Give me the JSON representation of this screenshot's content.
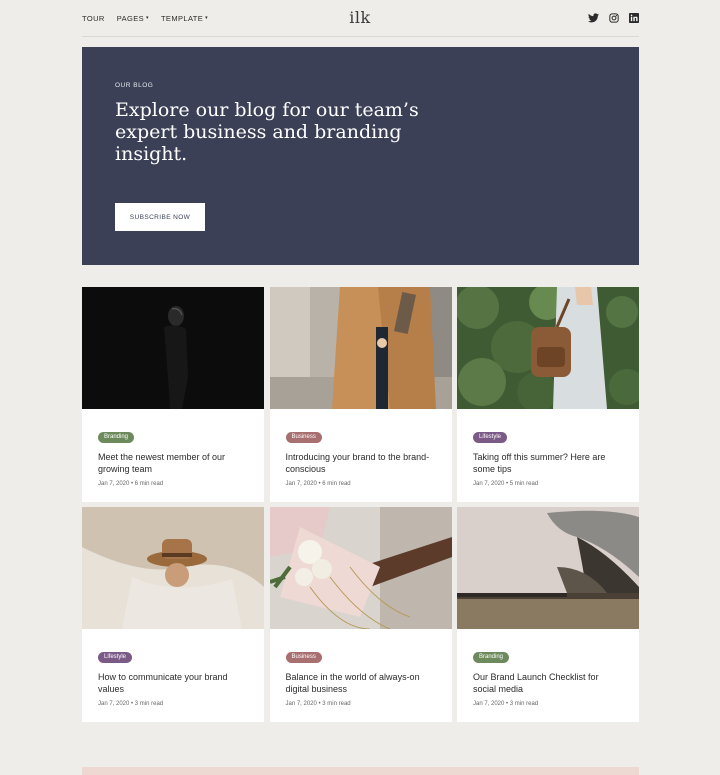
{
  "nav": {
    "items": [
      {
        "label": "TOUR",
        "has_caret": false
      },
      {
        "label": "PAGES",
        "has_caret": true
      },
      {
        "label": "TEMPLATE",
        "has_caret": true
      }
    ],
    "caret": "▾",
    "logo": "ilk",
    "social": [
      "twitter-icon",
      "instagram-icon",
      "linkedin-icon"
    ]
  },
  "hero": {
    "eyebrow": "OUR BLOG",
    "heading": "Explore our blog for our team’s expert business and branding insight.",
    "button_label": "SUBSCRIBE NOW",
    "background": "#3b4057"
  },
  "tag_colors": {
    "Branding": "#6d8a5c",
    "Business": "#a76f70",
    "Lifestyle": "#7b5a87"
  },
  "posts": [
    {
      "tag": "Branding",
      "title": "Meet the newest member of our growing team",
      "date": "Jan 7, 2020",
      "read": "6 min read",
      "image": "dark-portrait-photo"
    },
    {
      "tag": "Business",
      "title": "Introducing your brand to the brand-conscious",
      "date": "Jan 7, 2020",
      "read": "6 min read",
      "image": "camel-coat-photo"
    },
    {
      "tag": "Lifestyle",
      "title": "Taking off this summer? Here are some tips",
      "date": "Jan 7, 2020",
      "read": "5 min read",
      "image": "backpack-hedge-photo"
    },
    {
      "tag": "Lifestyle",
      "title": "How to communicate your brand values",
      "date": "Jan 7, 2020",
      "read": "3 min read",
      "image": "hat-veil-photo"
    },
    {
      "tag": "Business",
      "title": "Balance in the world of always-on digital business",
      "date": "Jan 7, 2020",
      "read": "3 min read",
      "image": "flowers-photo"
    },
    {
      "tag": "Branding",
      "title": "Our Brand Launch Checklist for social media",
      "date": "Jan 7, 2020",
      "read": "3 min read",
      "image": "opera-house-photo"
    }
  ]
}
